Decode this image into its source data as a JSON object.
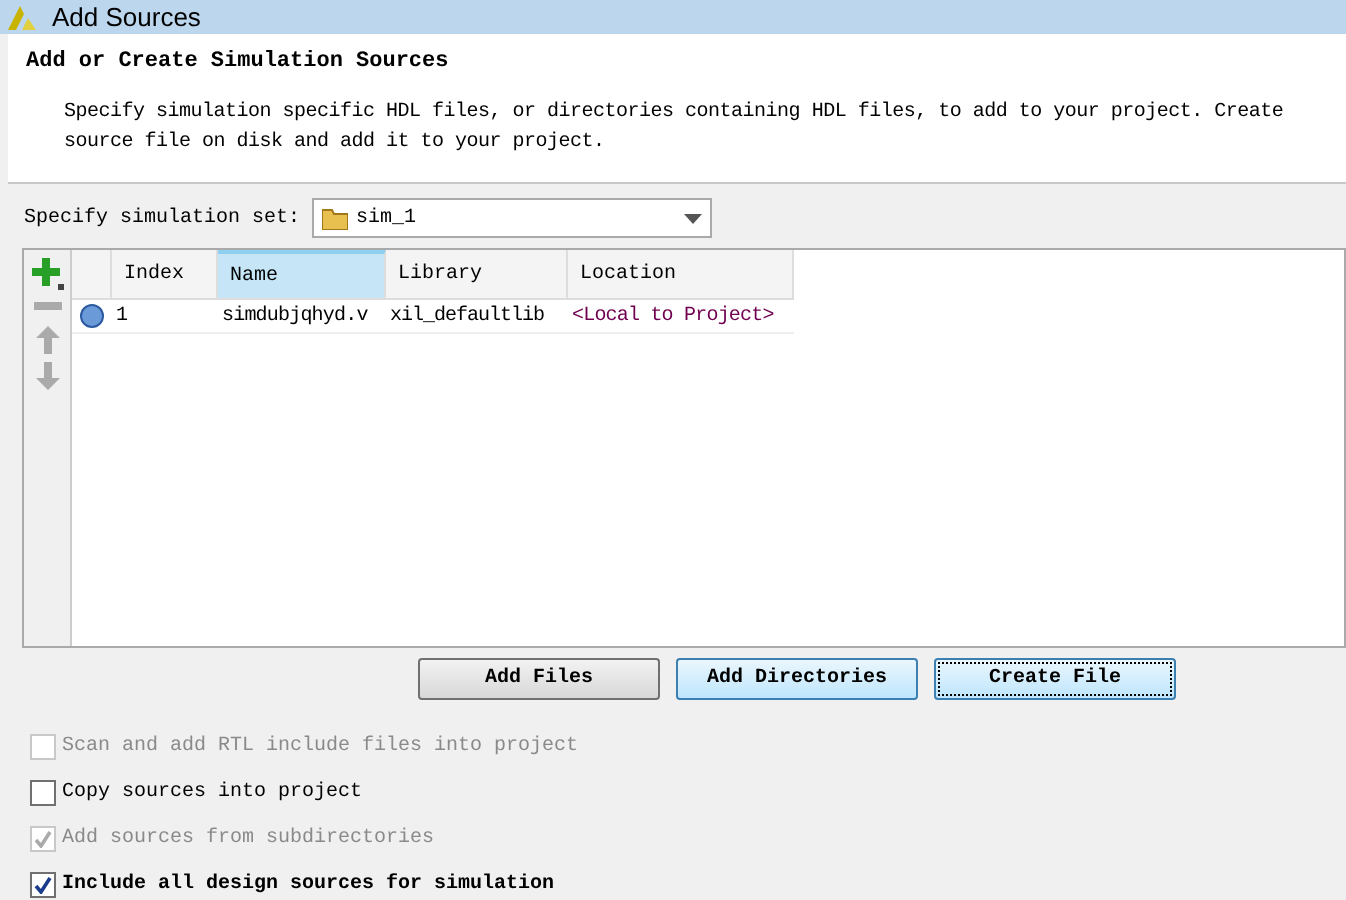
{
  "window": {
    "title": "Add Sources"
  },
  "header": {
    "title": "Add or Create Simulation Sources",
    "description_lines": [
      "Specify simulation specific HDL files, or directories containing HDL files, to add to your project. Create",
      "source file on disk and add it to your project."
    ]
  },
  "simulation_set": {
    "label": "Specify simulation set:",
    "value": "sim_1"
  },
  "table": {
    "columns": [
      {
        "label": "Index",
        "selected": false
      },
      {
        "label": "Name",
        "selected": true
      },
      {
        "label": "Library",
        "selected": false
      },
      {
        "label": "Location",
        "selected": false
      }
    ],
    "rows": [
      {
        "index": "1",
        "name": "simdubjqhyd.v",
        "library": "xil_defaultlib",
        "location": "<Local to Project>"
      }
    ]
  },
  "buttons": [
    {
      "label": "Add Files",
      "highlighted": false,
      "focused": false
    },
    {
      "label": "Add Directories",
      "highlighted": true,
      "focused": false
    },
    {
      "label": "Create File",
      "highlighted": true,
      "focused": true
    }
  ],
  "options": [
    {
      "label": "Scan and add RTL include files into project",
      "checked": false,
      "disabled": true
    },
    {
      "label": "Copy sources into project",
      "checked": false,
      "disabled": false
    },
    {
      "label": "Add sources from subdirectories",
      "checked": true,
      "disabled": true
    },
    {
      "label": "Include all design sources for simulation",
      "checked": true,
      "disabled": false
    }
  ]
}
